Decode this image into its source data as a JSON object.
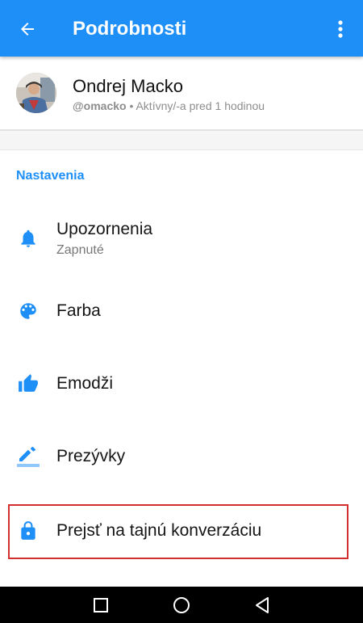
{
  "appbar": {
    "title": "Podrobnosti",
    "back_icon": "arrow-back-icon",
    "more_icon": "more-vert-icon",
    "color": "#1e8ff7"
  },
  "profile": {
    "name": "Ondrej Macko",
    "handle": "@omacko",
    "status": " • Aktívny/-a pred 1 hodinou"
  },
  "settings": {
    "header": "Nastavenia",
    "items": [
      {
        "label": "Upozornenia",
        "sublabel": "Zapnuté",
        "icon": "bell-icon"
      },
      {
        "label": "Farba",
        "icon": "palette-icon"
      },
      {
        "label": "Emodži",
        "icon": "thumbs-up-icon"
      },
      {
        "label": "Prezývky",
        "icon": "pencil-icon"
      },
      {
        "label": "Prejsť na tajnú konverzáciu",
        "icon": "lock-icon",
        "highlighted": true
      }
    ]
  },
  "navbar": {
    "buttons": [
      "recents-square-icon",
      "home-circle-icon",
      "back-triangle-icon"
    ]
  }
}
